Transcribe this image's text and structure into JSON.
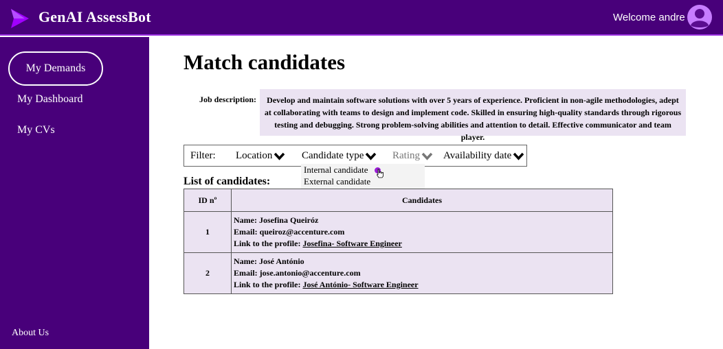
{
  "header": {
    "app_title": "GenAI AssessBot",
    "welcome_text": "Welcome andre",
    "logo_icon": "chevron-right-logo-icon",
    "avatar_icon": "user-avatar-icon"
  },
  "sidebar": {
    "items": [
      {
        "label": "My Demands",
        "active": true
      },
      {
        "label": "My Dashboard",
        "active": false
      },
      {
        "label": "My CVs",
        "active": false
      }
    ],
    "footer": "About Us"
  },
  "main": {
    "title": "Match candidates",
    "job_description_label": "Job description:",
    "job_description": "Develop and maintain software solutions with over 5 years of experience. Proficient in non-agile methodologies, adept at collaborating with teams to design and implement code. Skilled in ensuring high-quality standards through rigorous testing and debugging. Strong problem-solving abilities and attention to detail. Effective communicator and team player.",
    "filter": {
      "label": "Filter:",
      "dropdowns": [
        "Location",
        "Candidate type",
        "Rating",
        "Availability date"
      ],
      "candidate_type_options": [
        "Internal candidate",
        "External candidate"
      ]
    },
    "list_title": "List of candidates:",
    "table": {
      "headers": [
        "ID nº",
        "Candidates"
      ],
      "rows": [
        {
          "id": "1",
          "name_line": "Name: Josefina Queiróz",
          "email_line": "Email: queiroz@accenture.com",
          "link_prefix": "Link to the profile: ",
          "link_text": "Josefina- Software Engineer"
        },
        {
          "id": "2",
          "name_line": "Name: José António",
          "email_line": "Email: jose.antonio@accenture.com",
          "link_prefix": "Link to the profile: ",
          "link_text": "José António- Software Engineer"
        }
      ]
    }
  },
  "colors": {
    "brand_purple": "#48007a",
    "accent_purple": "#9b30e0",
    "panel_lavender": "#ebe3f2"
  }
}
